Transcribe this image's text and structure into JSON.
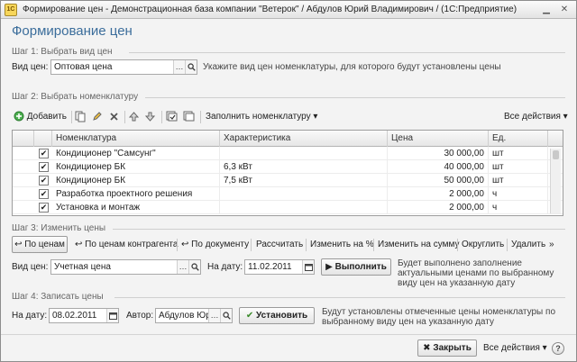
{
  "window": {
    "title": "Формирование цен - Демонстрационная база компании \"Ветерок\" / Абдулов Юрий Владимирович / (1С:Предприятие)",
    "app_icon": "1С"
  },
  "form": {
    "title": "Формирование цен"
  },
  "step1": {
    "label": "Шаг 1: Выбрать вид цен",
    "field_label": "Вид цен:",
    "field_value": "Оптовая цена",
    "hint": "Укажите вид цен номенклатуры, для которого будут установлены цены"
  },
  "step2": {
    "label": "Шаг 2: Выбрать номенклатуру",
    "toolbar": {
      "add_label": "Добавить",
      "fill_label": "Заполнить номенклатуру",
      "all_actions_label": "Все действия"
    },
    "table": {
      "columns": [
        "Номенклатура",
        "Характеристика",
        "Цена",
        "Ед."
      ],
      "rows": [
        {
          "checked": true,
          "item": "Кондиционер \"Самсунг\"",
          "characteristic": "",
          "price": "30 000,00",
          "unit": "шт"
        },
        {
          "checked": true,
          "item": "Кондиционер БК",
          "characteristic": "6,3 кВт",
          "price": "40 000,00",
          "unit": "шт"
        },
        {
          "checked": true,
          "item": "Кондиционер БК",
          "characteristic": "7,5 кВт",
          "price": "50 000,00",
          "unit": "шт"
        },
        {
          "checked": true,
          "item": "Разработка проектного решения",
          "characteristic": "",
          "price": "2 000,00",
          "unit": "ч"
        },
        {
          "checked": true,
          "item": "Установка и монтаж",
          "characteristic": "",
          "price": "2 000,00",
          "unit": "ч"
        }
      ]
    }
  },
  "step3": {
    "label": "Шаг 3: Изменить цены",
    "toolbar": {
      "by_prices": "По ценам",
      "by_contractor_prices": "По ценам контрагента",
      "by_document": "По документу",
      "calculate": "Рассчитать",
      "change_percent": "Изменить на %",
      "change_amount": "Изменить на сумму",
      "round": "Округлить",
      "delete": "Удалить"
    },
    "price_type_label": "Вид цен:",
    "price_type_value": "Учетная цена",
    "date_label": "На дату:",
    "date_value": "11.02.2011",
    "execute_label": "Выполнить",
    "hint": "Будет выполнено заполнение актуальными ценами по выбранному виду цен на указанную дату"
  },
  "step4": {
    "label": "Шаг 4: Записать цены",
    "date_label": "На дату:",
    "date_value": "08.02.2011",
    "author_label": "Автор:",
    "author_value": "Абдулов Юрий",
    "set_label": "Установить",
    "hint": "Будут установлены отмеченные цены номенклатуры по выбранному виду цен на указанную дату"
  },
  "footer": {
    "close_label": "Закрыть",
    "all_actions_label": "Все действия",
    "help": "?"
  },
  "colors": {
    "accent": "#3b6d9b",
    "check_green": "#3a8a2a",
    "delete_red": "#c0392b"
  }
}
